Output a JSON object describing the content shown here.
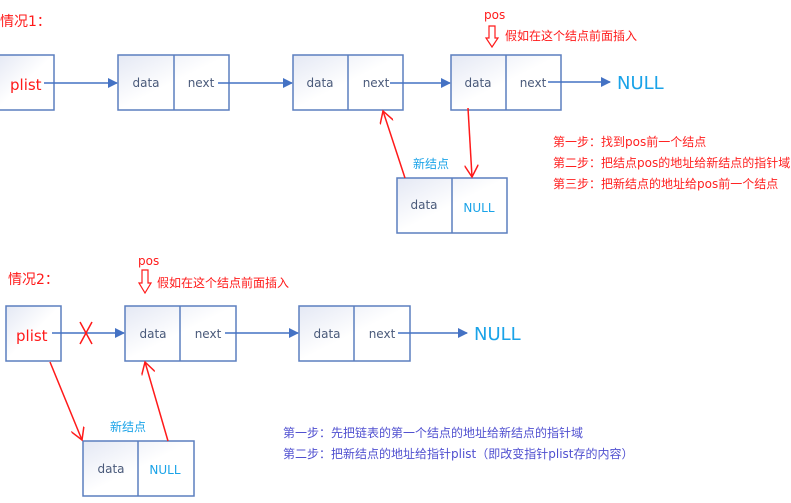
{
  "case1": {
    "title": "情况1：",
    "plist": "plist",
    "nodes": [
      {
        "data": "data",
        "next": "next"
      },
      {
        "data": "data",
        "next": "next"
      },
      {
        "data": "data",
        "next": "next"
      }
    ],
    "null_label": "NULL",
    "pos_label": "pos",
    "insert_note": "假如在这个结点前面插入",
    "new_node_label": "新结点",
    "new_node": {
      "data": "data",
      "next": "NULL"
    },
    "steps": [
      "第一步：找到pos前一个结点",
      "第二步：把结点pos的地址给新结点的指针域",
      "第三步：把新结点的地址给pos前一个结点"
    ]
  },
  "case2": {
    "title": "情况2：",
    "plist": "plist",
    "nodes": [
      {
        "data": "data",
        "next": "next"
      },
      {
        "data": "data",
        "next": "next"
      }
    ],
    "null_label": "NULL",
    "pos_label": "pos",
    "insert_note": "假如在这个结点前面插入",
    "new_node_label": "新结点",
    "new_node": {
      "data": "data",
      "next": "NULL"
    },
    "steps": [
      "第一步：先把链表的第一个结点的地址给新结点的指针域",
      "第二步：把新结点的地址给指针plist（即改变指针plist存的内容）"
    ]
  },
  "colors": {
    "link": "#4472c4",
    "annotation": "#ff1a1a",
    "null": "#1aa3e8",
    "steps2": "#5050d0"
  }
}
